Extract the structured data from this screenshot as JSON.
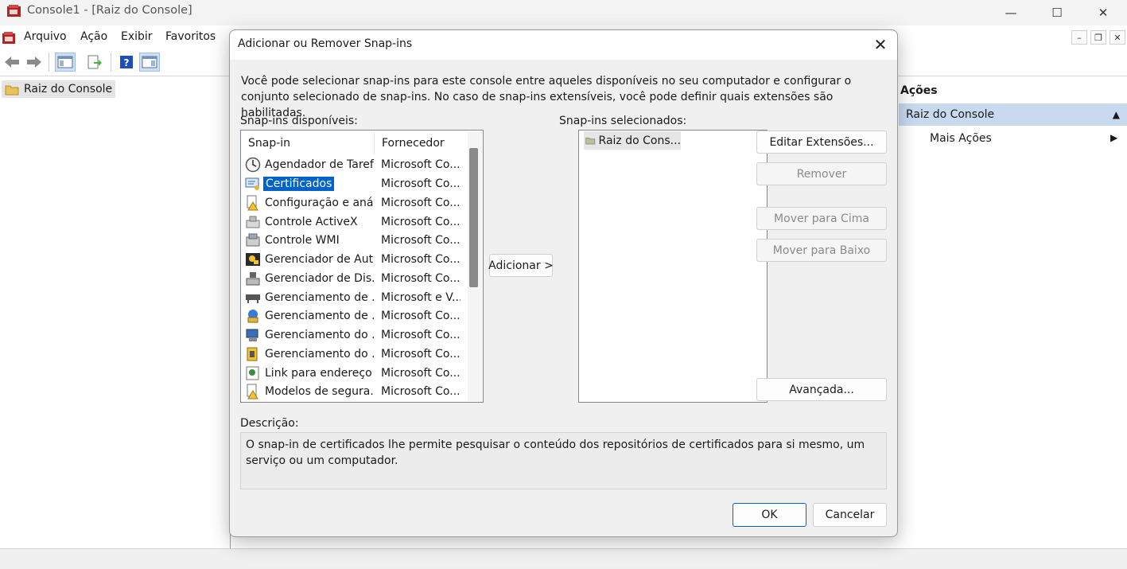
{
  "window": {
    "title": "Console1 - [Raiz do Console]",
    "controls": {
      "minimize": "—",
      "maximize": "☐",
      "close": "✕"
    }
  },
  "menu": {
    "items": [
      "Arquivo",
      "Ação",
      "Exibir",
      "Favoritos"
    ]
  },
  "mdi_controls": {
    "minimize": "–",
    "restore": "❐",
    "close": "✕"
  },
  "left_pane": {
    "tree_root": "Raiz do Console"
  },
  "actions_pane": {
    "header": "Ações",
    "root": "Raiz do Console",
    "more_actions": "Mais Ações"
  },
  "dialog": {
    "title": "Adicionar ou Remover Snap-ins",
    "intro": "Você pode selecionar snap-ins para este console entre aqueles disponíveis no seu computador e configurar o conjunto selecionado de snap-ins. No caso de snap-ins extensíveis, você pode definir quais extensões são habilitadas.",
    "available_label": "Snap-ins disponíveis:",
    "selected_label": "Snap-ins selecionados:",
    "columns": {
      "snapin": "Snap-in",
      "vendor": "Fornecedor"
    },
    "available": [
      {
        "name": "Agendador de Taref...",
        "vendor": "Microsoft Co...",
        "icon": "clock-icon"
      },
      {
        "name": "Certificados",
        "vendor": "Microsoft Co...",
        "icon": "certificate-icon",
        "selected": true
      },
      {
        "name": "Configuração e aná...",
        "vendor": "Microsoft Co...",
        "icon": "security-config-icon"
      },
      {
        "name": "Controle ActiveX",
        "vendor": "Microsoft Co...",
        "icon": "activex-icon"
      },
      {
        "name": "Controle WMI",
        "vendor": "Microsoft Co...",
        "icon": "wmi-icon"
      },
      {
        "name": "Gerenciador de Aut...",
        "vendor": "Microsoft Co...",
        "icon": "authorization-icon"
      },
      {
        "name": "Gerenciador de Dis...",
        "vendor": "Microsoft Co...",
        "icon": "device-manager-icon"
      },
      {
        "name": "Gerenciamento de ...",
        "vendor": "Microsoft e V...",
        "icon": "disk-management-icon"
      },
      {
        "name": "Gerenciamento de ...",
        "vendor": "Microsoft Co...",
        "icon": "policy-management-icon"
      },
      {
        "name": "Gerenciamento do ...",
        "vendor": "Microsoft Co...",
        "icon": "computer-management-icon"
      },
      {
        "name": "Gerenciamento do ...",
        "vendor": "Microsoft Co...",
        "icon": "tpm-management-icon"
      },
      {
        "name": "Link para endereço ...",
        "vendor": "Microsoft Co...",
        "icon": "web-link-icon"
      },
      {
        "name": "Modelos de segura...",
        "vendor": "Microsoft Co...",
        "icon": "security-templates-icon"
      }
    ],
    "add_button": "Adicionar >",
    "selected_items": [
      "Raiz do Cons..."
    ],
    "buttons": {
      "edit_extensions": "Editar Extensões...",
      "remove": "Remover",
      "move_up": "Mover para Cima",
      "move_down": "Mover para Baixo",
      "advanced": "Avançada..."
    },
    "description_label": "Descrição:",
    "description": "O snap-in de certificados lhe permite pesquisar o conteúdo dos repositórios de certificados para si mesmo, um serviço ou um computador.",
    "ok": "OK",
    "cancel": "Cancelar"
  },
  "colors": {
    "selection": "#0063cc",
    "actions_highlight": "#c8daf0",
    "primary_border": "#0067c0"
  }
}
